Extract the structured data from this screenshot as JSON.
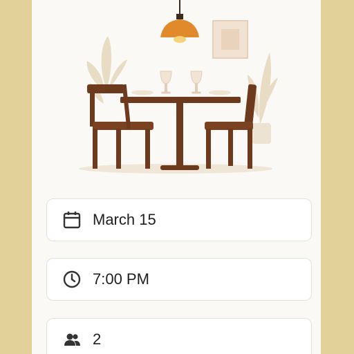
{
  "illustration": {
    "icon": "dining-table-illustration"
  },
  "booking": {
    "date": {
      "value": "March 15",
      "icon": "calendar-icon"
    },
    "time": {
      "value": "7:00 PM",
      "icon": "clock-icon"
    },
    "guests": {
      "value": "2",
      "icon": "people-icon"
    }
  },
  "colors": {
    "background": "#e3d19a",
    "panel": "#fbf9f6",
    "wood": "#6e3a1e",
    "lamp": "#e08a2c"
  }
}
